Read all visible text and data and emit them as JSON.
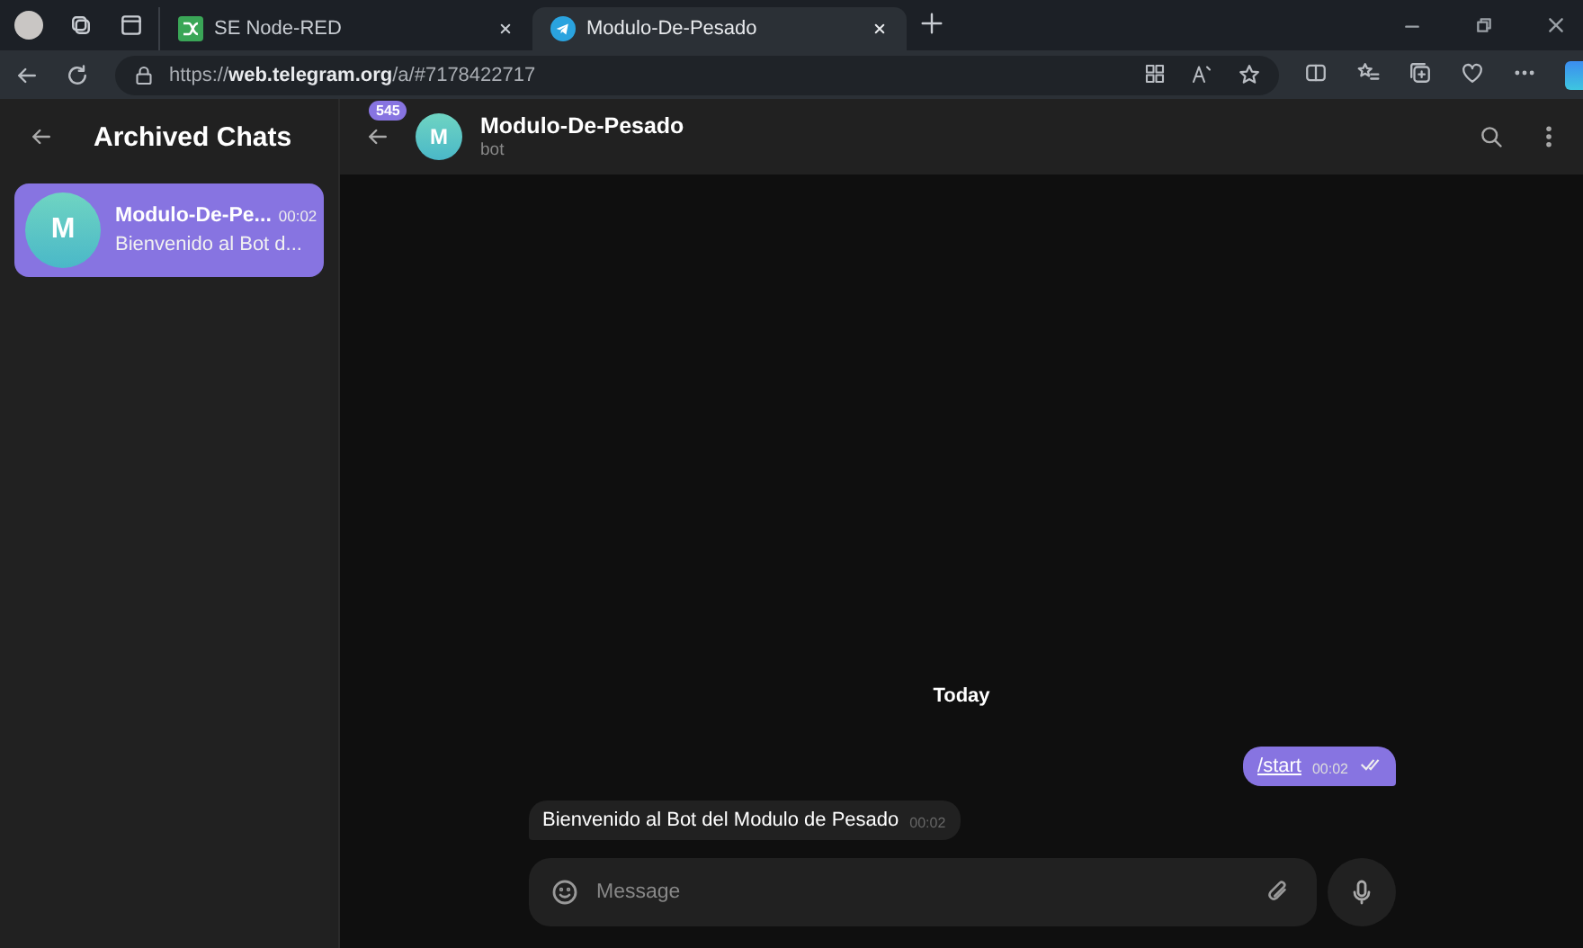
{
  "browser": {
    "tabs": [
      {
        "title": "SE Node-RED",
        "kind": "nodered",
        "selected": false
      },
      {
        "title": "Modulo-De-Pesado",
        "kind": "telegram",
        "selected": true
      }
    ],
    "url": "https://**web.telegram.org**/a/#7178422717"
  },
  "sidebar": {
    "title": "Archived Chats",
    "chats": [
      {
        "avatar": "M",
        "name": "Modulo-De-Pe...",
        "time": "00:02",
        "preview": "Bienvenido al Bot d...",
        "selected": true
      }
    ]
  },
  "chat": {
    "unread_badge": "545",
    "avatar": "M",
    "name": "Modulo-De-Pesado",
    "status": "bot",
    "date_label": "Today",
    "messages": [
      {
        "kind": "outgoing",
        "text": "/start",
        "time": "00:02",
        "read": true
      },
      {
        "kind": "incoming",
        "text": "Bienvenido al Bot del Modulo de Pesado",
        "time": "00:02"
      }
    ],
    "composer": {
      "placeholder": "Message"
    }
  }
}
